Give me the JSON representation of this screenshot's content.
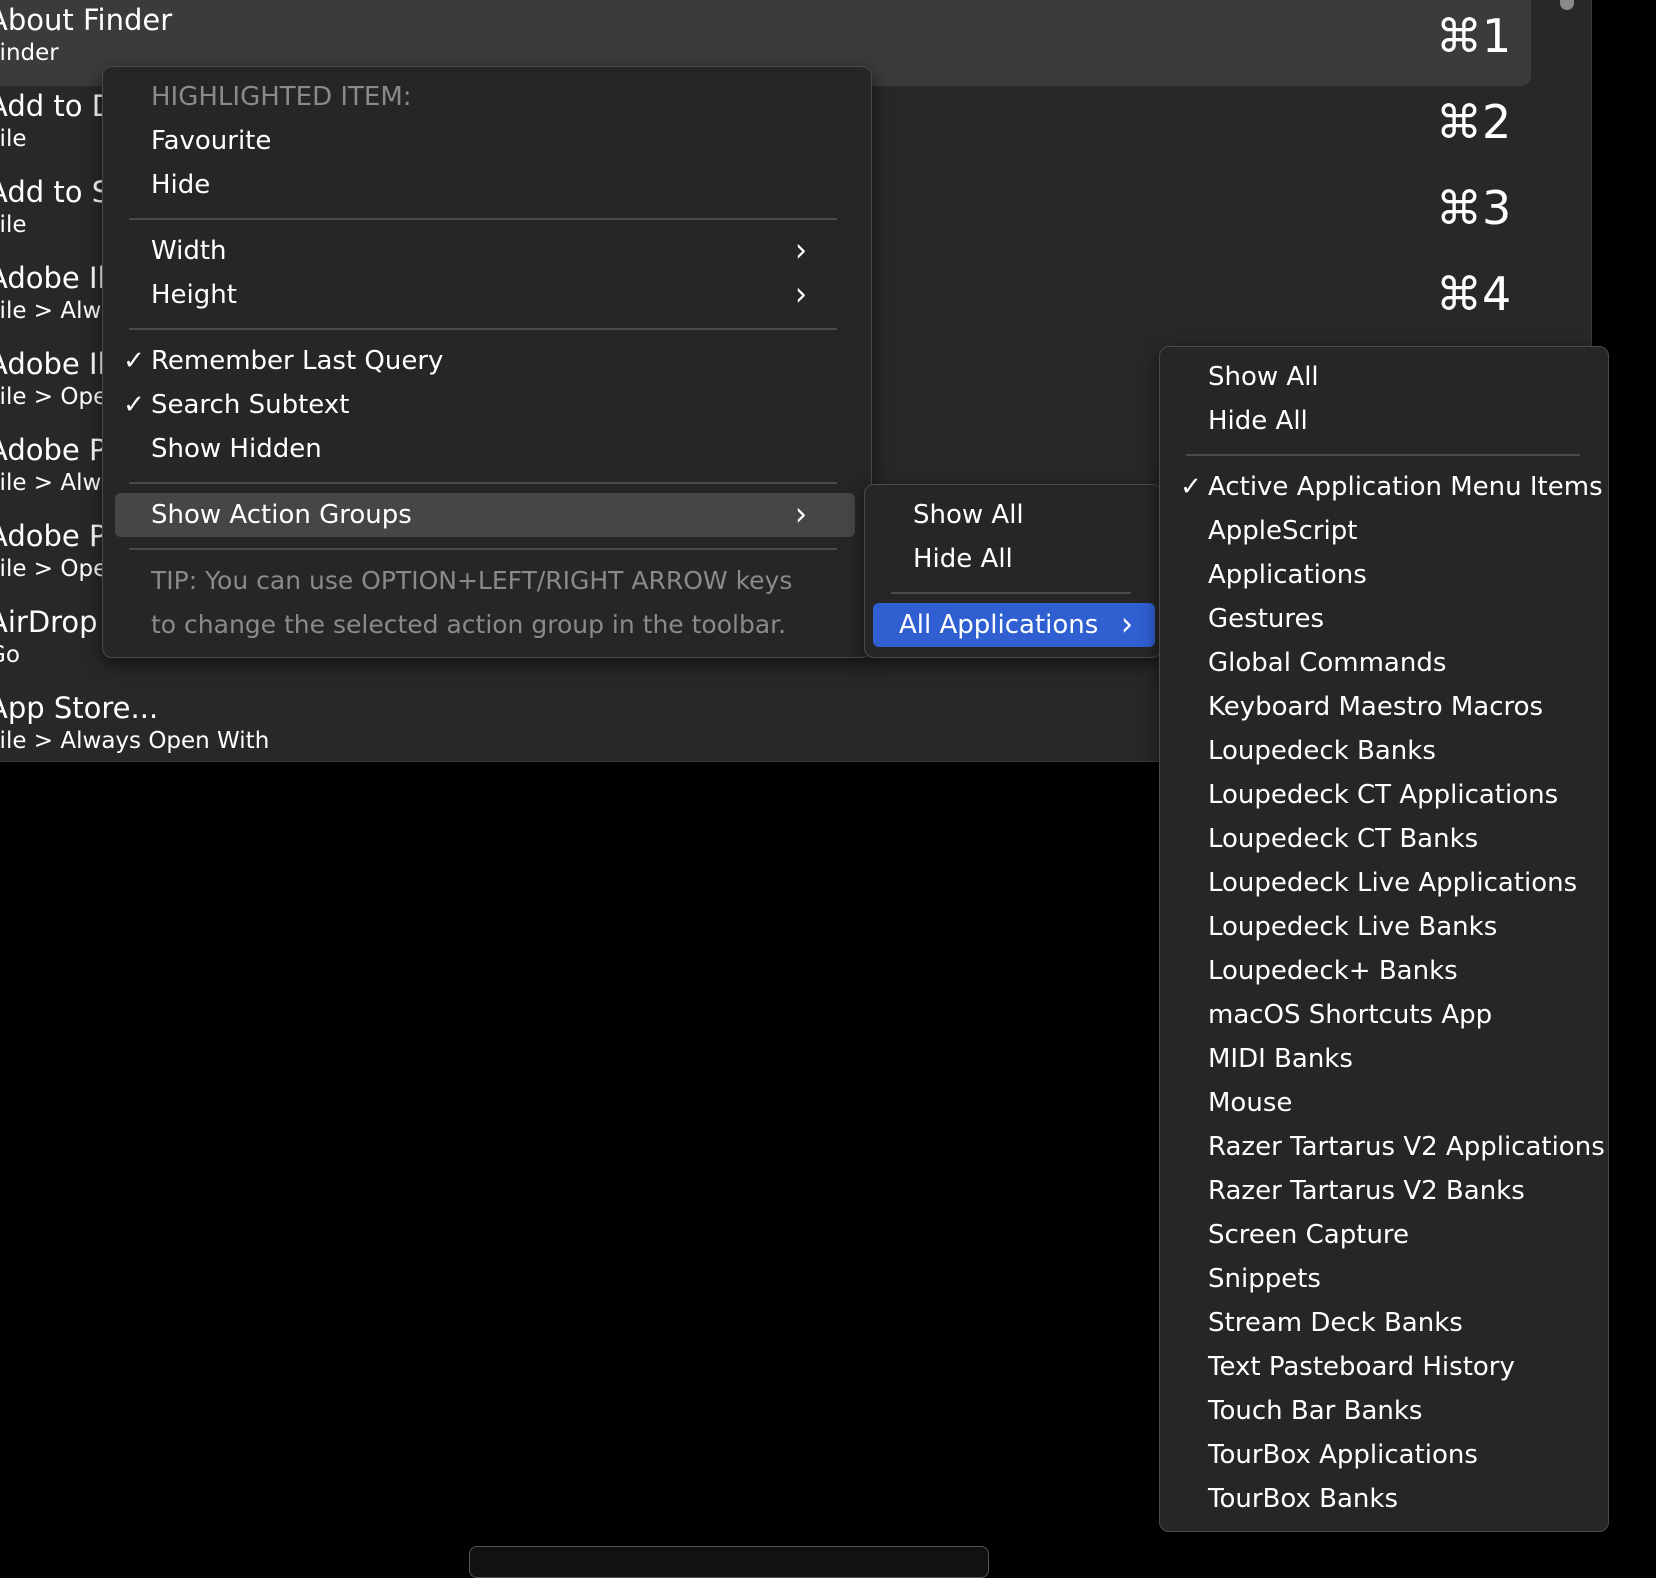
{
  "results": [
    {
      "title": "About Finder",
      "subtitle": "Finder",
      "shortcut": "⌘1"
    },
    {
      "title": "Add to D",
      "subtitle": "File",
      "shortcut": "⌘2"
    },
    {
      "title": "Add to S",
      "subtitle": "File",
      "shortcut": "⌘3"
    },
    {
      "title": "Adobe Il",
      "subtitle": "File > Alwa",
      "shortcut": "⌘4"
    },
    {
      "title": "Adobe Il",
      "subtitle": "File > Ope",
      "shortcut": ""
    },
    {
      "title": "Adobe P",
      "subtitle": "File > Alwa",
      "shortcut": ""
    },
    {
      "title": "Adobe P",
      "subtitle": "File > Ope",
      "shortcut": ""
    },
    {
      "title": "AirDrop",
      "subtitle": "Go",
      "shortcut": ""
    },
    {
      "title": "App Store...",
      "subtitle": "File > Always Open With",
      "shortcut": ""
    }
  ],
  "context_menu": {
    "header": "HIGHLIGHTED ITEM:",
    "favourite": "Favourite",
    "hide": "Hide",
    "width": "Width",
    "height": "Height",
    "remember_last_query": "Remember Last Query",
    "search_subtext": "Search Subtext",
    "show_hidden": "Show Hidden",
    "show_action_groups": "Show Action Groups",
    "tip_line1": "TIP: You can use OPTION+LEFT/RIGHT ARROW keys",
    "tip_line2": "to change the selected action group in the toolbar.",
    "checkmark": "✓",
    "chevron": "›"
  },
  "submenu1": {
    "show_all": "Show All",
    "hide_all": "Hide All",
    "all_applications": "All Applications"
  },
  "submenu2": {
    "show_all": "Show All",
    "hide_all": "Hide All",
    "groups": [
      {
        "label": "Active Application Menu Items",
        "checked": true
      },
      {
        "label": "AppleScript"
      },
      {
        "label": "Applications"
      },
      {
        "label": "Gestures"
      },
      {
        "label": "Global Commands"
      },
      {
        "label": "Keyboard Maestro Macros"
      },
      {
        "label": "Loupedeck Banks"
      },
      {
        "label": "Loupedeck CT Applications"
      },
      {
        "label": "Loupedeck CT Banks"
      },
      {
        "label": "Loupedeck Live Applications"
      },
      {
        "label": "Loupedeck Live Banks"
      },
      {
        "label": "Loupedeck+ Banks"
      },
      {
        "label": "macOS Shortcuts App"
      },
      {
        "label": "MIDI Banks"
      },
      {
        "label": "Mouse"
      },
      {
        "label": "Razer Tartarus V2 Applications"
      },
      {
        "label": "Razer Tartarus V2 Banks"
      },
      {
        "label": "Screen Capture"
      },
      {
        "label": "Snippets"
      },
      {
        "label": "Stream Deck Banks"
      },
      {
        "label": "Text Pasteboard History"
      },
      {
        "label": "Touch Bar Banks"
      },
      {
        "label": "TourBox Applications"
      },
      {
        "label": "TourBox Banks"
      }
    ]
  },
  "colors": {
    "highlight_blue": "#2f5fd1",
    "panel": "#282828",
    "menu": "#262626"
  }
}
